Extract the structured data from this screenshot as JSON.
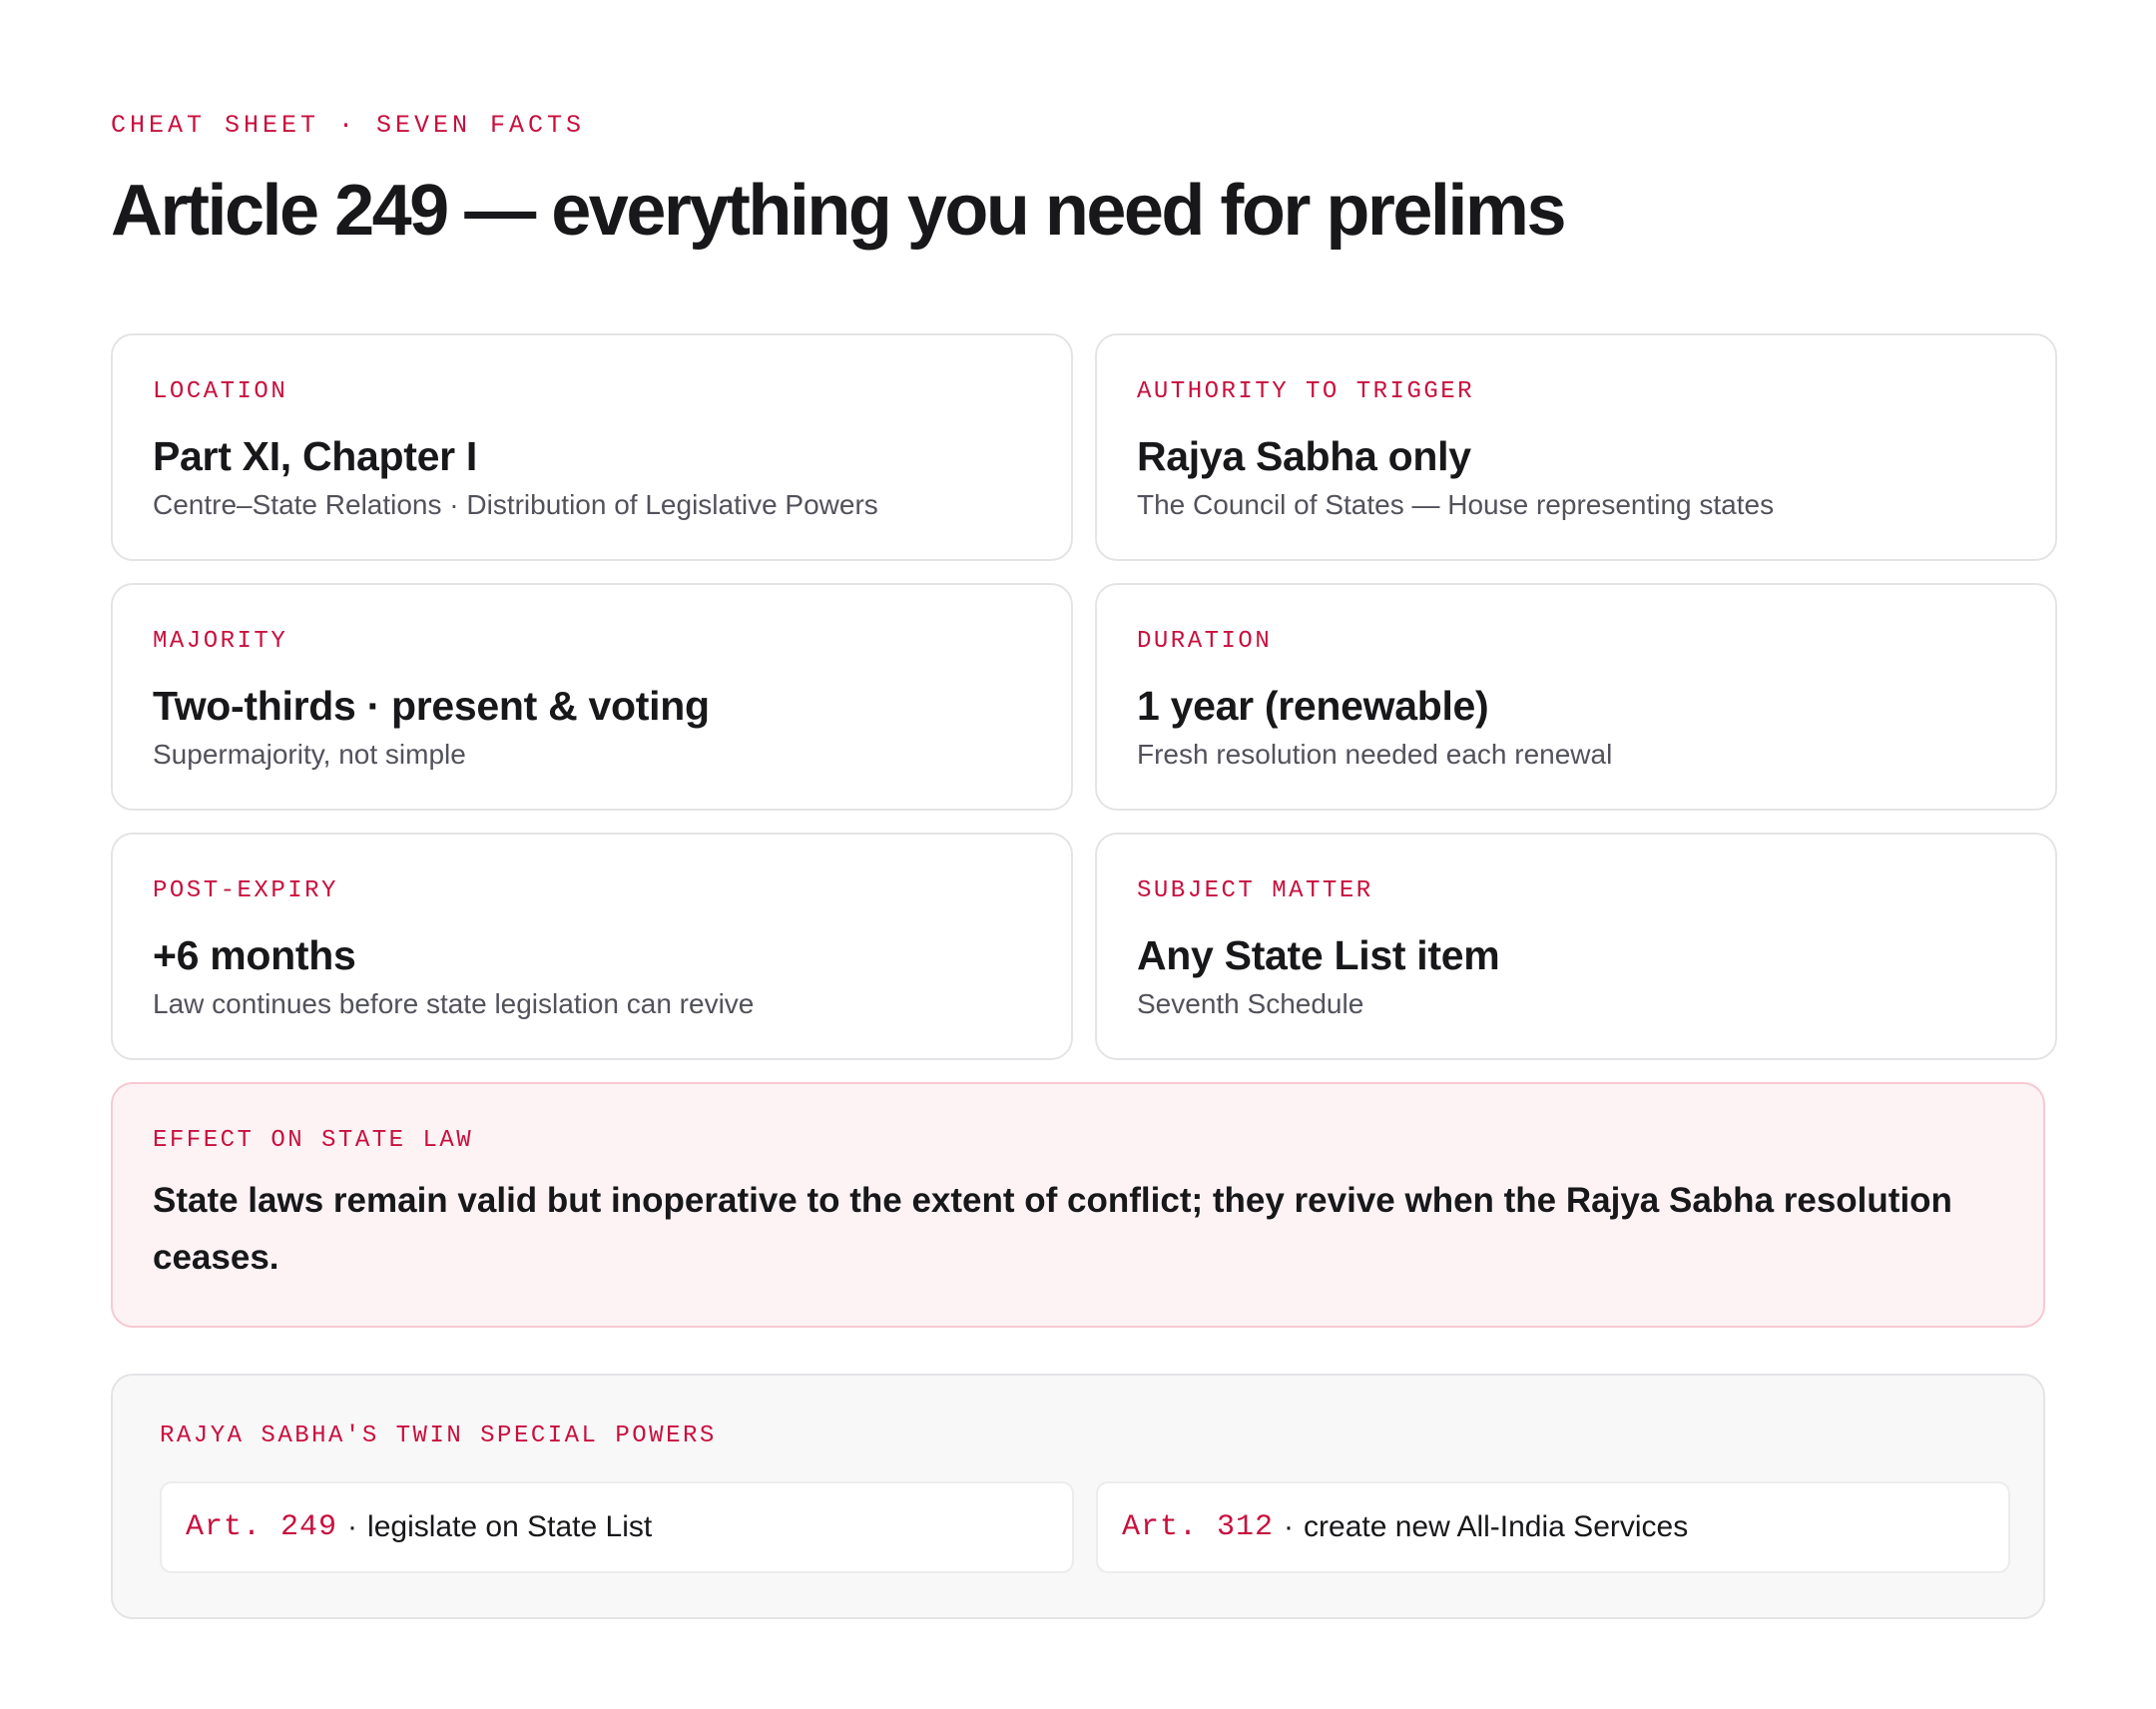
{
  "header": {
    "eyebrow": "CHEAT SHEET · SEVEN FACTS",
    "title": "Article 249 — everything you need for prelims"
  },
  "facts": [
    {
      "label": "LOCATION",
      "value": "Part XI, Chapter I",
      "sub": "Centre–State Relations · Distribution of Legislative Powers"
    },
    {
      "label": "AUTHORITY TO TRIGGER",
      "value": "Rajya Sabha only",
      "sub": "The Council of States — House representing states"
    },
    {
      "label": "MAJORITY",
      "value": "Two-thirds · present & voting",
      "sub": "Supermajority, not simple"
    },
    {
      "label": "DURATION",
      "value": "1 year (renewable)",
      "sub": "Fresh resolution needed each renewal"
    },
    {
      "label": "POST-EXPIRY",
      "value": "+6 months",
      "sub": "Law continues before state legislation can revive"
    },
    {
      "label": "SUBJECT MATTER",
      "value": "Any State List item",
      "sub": "Seventh Schedule"
    }
  ],
  "effect": {
    "label": "EFFECT ON STATE LAW",
    "text": "State laws remain valid but inoperative to the extent of conflict; they revive when the Rajya Sabha resolution ceases."
  },
  "powers": {
    "label": "RAJYA SABHA'S TWIN SPECIAL POWERS",
    "separator": "·",
    "items": [
      {
        "code": "Art. 249",
        "text": "legislate on State List"
      },
      {
        "code": "Art. 312",
        "text": "create new All-India Services"
      }
    ]
  },
  "colors": {
    "accent": "#c8103e",
    "effect_background": "#fdf3f5",
    "effect_border": "#f6c9d3",
    "powers_background": "#f8f8f9"
  }
}
